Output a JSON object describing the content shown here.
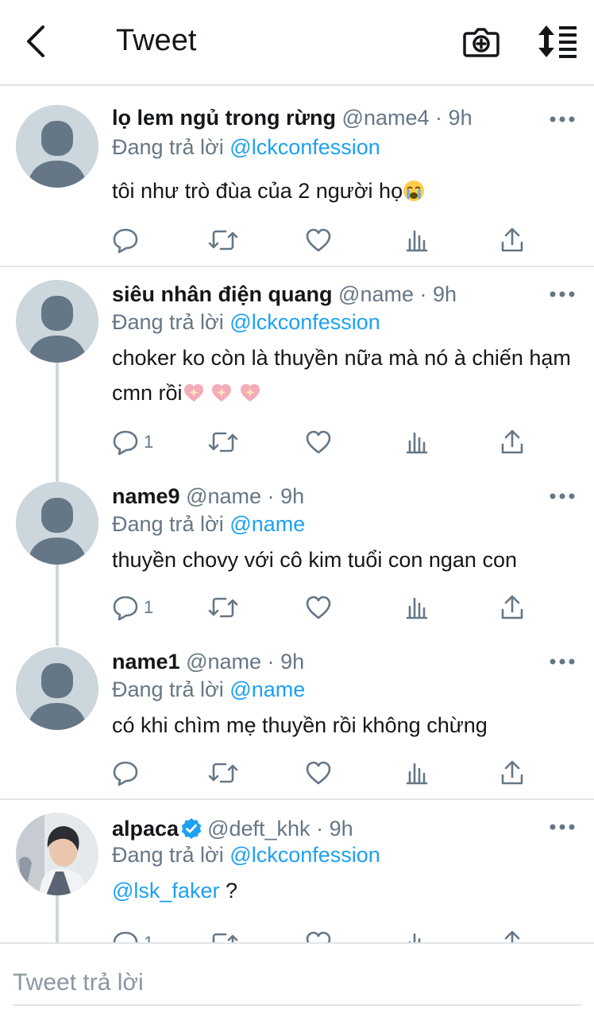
{
  "header": {
    "title": "Tweet",
    "icons": [
      "back-icon",
      "camera-add-icon",
      "sort-icon"
    ]
  },
  "tweets": [
    {
      "name": "lọ lem ngủ trong rừng",
      "handle": "@name4",
      "sep": "·",
      "time": "9h",
      "reply_prefix": "Đang trả lời",
      "reply_to": "@lckconfession",
      "text": "tôi như trò đùa của 2 người họ",
      "emoji": "loudly-crying-face-emoji",
      "reply_count": ""
    },
    {
      "name": "siêu nhân điện quang",
      "handle": "@name",
      "sep": "·",
      "time": "9h",
      "reply_prefix": "Đang trả lời",
      "reply_to": "@lckconfession",
      "text": "choker ko còn là thuyền nữa mà nó à chiến hạm cmn rồi",
      "emoji": "sparkling-heart-emoji",
      "reply_count": "1"
    },
    {
      "name": "name9",
      "handle": "@name",
      "sep": "·",
      "time": "9h",
      "reply_prefix": "Đang trả lời",
      "reply_to": "@name",
      "text": "thuyền chovy với cô kim tuổi con ngan con",
      "reply_count": "1"
    },
    {
      "name": "name1",
      "handle": "@name",
      "sep": "·",
      "time": "9h",
      "reply_prefix": "Đang trả lời",
      "reply_to": "@name",
      "text": "có khi chìm mẹ thuyền rồi không chừng",
      "reply_count": ""
    },
    {
      "name": "alpaca",
      "handle": "@deft_khk",
      "sep": "·",
      "time": "9h",
      "reply_prefix": "Đang trả lời",
      "reply_to": "@lckconfession",
      "mention": "@lsk_faker",
      "text_suffix": " ?",
      "reply_count": "1"
    }
  ],
  "reply_bar": {
    "placeholder": "Tweet trả lời"
  },
  "colors": {
    "accent": "#1da1f2",
    "muted": "#657786",
    "text": "#14171a",
    "divider": "#e1e5e8",
    "avatar_placeholder": "#ccd6dd",
    "avatar_silhouette": "#657786"
  }
}
